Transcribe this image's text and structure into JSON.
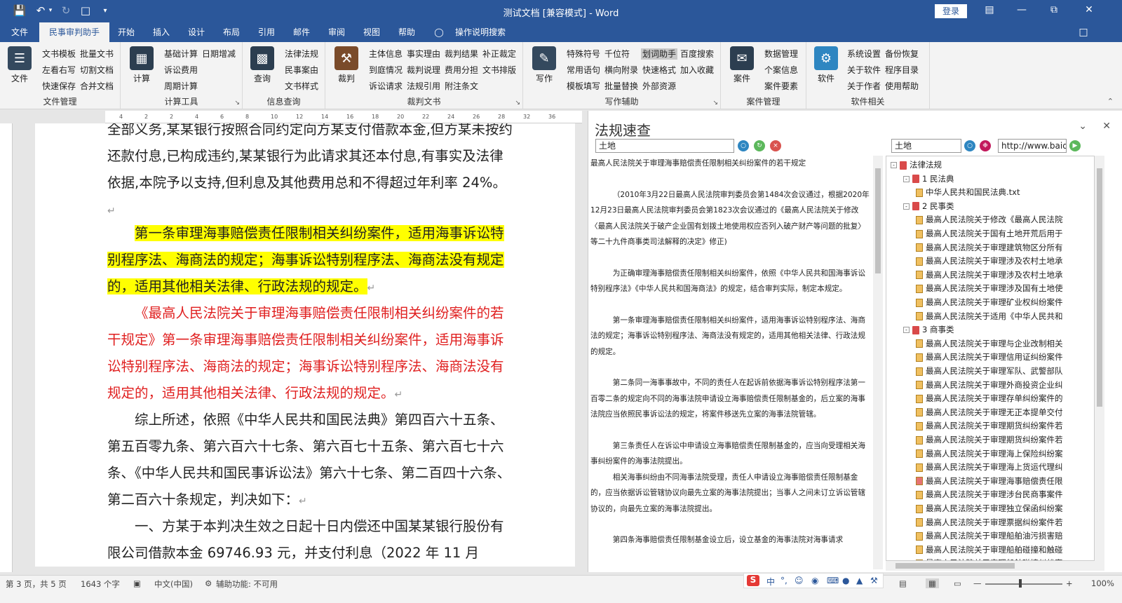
{
  "titlebar": {
    "title": "测试文档 [兼容模式] - Word",
    "login_label": "登录",
    "qa_icons": [
      "save-icon",
      "undo-icon",
      "redo-icon",
      "new-doc-icon",
      "customize-icon"
    ],
    "window_controls": [
      "ribbon-display-icon",
      "minimize-icon",
      "maximize-icon",
      "close-icon"
    ]
  },
  "tabs": [
    {
      "label": "文件"
    },
    {
      "label": "民事审判助手"
    },
    {
      "label": "开始"
    },
    {
      "label": "插入"
    },
    {
      "label": "设计"
    },
    {
      "label": "布局"
    },
    {
      "label": "引用"
    },
    {
      "label": "邮件"
    },
    {
      "label": "审阅"
    },
    {
      "label": "视图"
    },
    {
      "label": "帮助"
    },
    {
      "label": "操作说明搜索"
    }
  ],
  "ribbon": {
    "groups": [
      {
        "label": "文件管理",
        "big": "文件",
        "items": [
          "文书模板",
          "批量文书",
          "左看右写",
          "切割文档",
          "快速保存",
          "合并文档"
        ]
      },
      {
        "label": "计算工具",
        "big": "计算",
        "items": [
          "基础计算",
          "日期增减",
          "诉讼费用",
          "周期计算"
        ]
      },
      {
        "label": "信息查询",
        "big": "查询",
        "items": [
          "法律法规",
          "民事案由",
          "文书样式"
        ]
      },
      {
        "label": "裁判文书",
        "big": "裁判",
        "items": [
          "主体信息",
          "事实理由",
          "裁判结果",
          "补正裁定",
          "到庭情况",
          "裁判说理",
          "费用分担",
          "文书排版",
          "诉讼请求",
          "法规引用",
          "附注条文"
        ]
      },
      {
        "label": "写作辅助",
        "big": "写作",
        "items": [
          "特殊符号",
          "千位符",
          "划词助手",
          "百度搜索",
          "常用语句",
          "横向附录",
          "快速格式",
          "加入收藏",
          "模板填写",
          "批量替换",
          "外部资源"
        ]
      },
      {
        "label": "案件管理",
        "big": "案件",
        "items": [
          "数据管理",
          "个案信息",
          "案件要素"
        ]
      },
      {
        "label": "软件相关",
        "big": "软件",
        "items": [
          "系统设置",
          "备份恢复",
          "关于软件",
          "程序目录",
          "关于作者",
          "使用帮助"
        ]
      }
    ]
  },
  "ruler": {
    "numbers": [
      "4",
      "2",
      "2",
      "4",
      "6",
      "8",
      "10",
      "12",
      "14",
      "16",
      "18",
      "20",
      "22",
      "24",
      "26",
      "28",
      "32",
      "36"
    ]
  },
  "document": {
    "paragraphs": [
      {
        "text": "全部义务,某某银行按照合同约定向方某支付借款本金,但方某未按约还款付息,已构成违约,某某银行为此请求其还本付息,有事实及法律依据,本院予以支持,但利息及其他费用总和不得超过年利率 24%。",
        "style": "normal"
      },
      {
        "text": "第一条审理海事赔偿责任限制相关纠纷案件，适用海事诉讼特别程序法、海商法的规定；海事诉讼特别程序法、海商法没有规定的，适用其他相关法律、行政法规的规定。",
        "style": "highlight"
      },
      {
        "text": "《最高人民法院关于审理海事赔偿责任限制相关纠纷案件的若干规定》第一条审理海事赔偿责任限制相关纠纷案件，适用海事诉讼特别程序法、海商法的规定；海事诉讼特别程序法、海商法没有规定的，适用其他相关法律、行政法规的规定。",
        "style": "red"
      },
      {
        "text": "综上所述，依照《中华人民共和国民法典》第四百六十五条、第五百零九条、第六百六十七条、第六百七十五条、第六百七十六条、《中华人民共和国民事诉讼法》第六十七条、第二百四十六条、第二百六十条规定，判决如下：",
        "style": "normal"
      },
      {
        "text": "一、方某于本判决生效之日起十日内偿还中国某某银行股份有限公司借款本金 69746.93 元，并支付利息（2022 年 11 月",
        "style": "normal"
      }
    ]
  },
  "sidepanel": {
    "title": "法规速查",
    "search_left": "土地",
    "search_right": "土地",
    "url": "http://www.baidu",
    "law_text": [
      "最高人民法院关于审理海事赔偿责任限制相关纠纷案件的若干规定",
      "",
      "（2010年3月22日最高人民法院审判委员会第1484次会议通过，根据2020年12月23日最高人民法院审判委员会第1823次会议通过的《最高人民法院关于修改〈最高人民法院关于破产企业国有划拨土地使用权应否列入破产财产等问题的批复〉等二十九件商事类司法解释的决定》修正)",
      "",
      "为正确审理海事赔偿责任限制相关纠纷案件，依照《中华人民共和国海事诉讼特别程序法》《中华人民共和国海商法》的规定，结合审判实际，制定本规定。",
      "",
      "第一条审理海事赔偿责任限制相关纠纷案件，适用海事诉讼特别程序法、海商法的规定；海事诉讼特别程序法、海商法没有规定的，适用其他相关法律、行政法规的规定。",
      "",
      "第二条同一海事事故中，不同的责任人在起诉前依据海事诉讼特别程序法第一百零二条的规定向不同的海事法院申请设立海事赔偿责任限制基金的，后立案的海事法院应当依照民事诉讼法的规定，将案件移送先立案的海事法院管辖。",
      "",
      "第三条责任人在诉讼中申请设立海事赔偿责任限制基金的，应当向受理相关海事纠纷案件的海事法院提出。",
      "相关海事纠纷由不同海事法院受理，责任人申请设立海事赔偿责任限制基金的，应当依据诉讼管辖协议向最先立案的海事法院提出；当事人之间未订立诉讼管辖协议的，向最先立案的海事法院提出。",
      "",
      "第四条海事赔偿责任限制基金设立后，设立基金的海事法院对海事请求"
    ],
    "tree": [
      {
        "level": 0,
        "type": "book",
        "toggle": "-",
        "label": "法律法规"
      },
      {
        "level": 1,
        "type": "book",
        "toggle": "-",
        "label": "1 民法典"
      },
      {
        "level": 2,
        "type": "file",
        "label": "中华人民共和国民法典.txt"
      },
      {
        "level": 1,
        "type": "book",
        "toggle": "-",
        "label": "2 民事类"
      },
      {
        "level": 2,
        "type": "file",
        "label": "最高人民法院关于修改《最高人民法院"
      },
      {
        "level": 2,
        "type": "file",
        "label": "最高人民法院关于国有土地开荒后用于"
      },
      {
        "level": 2,
        "type": "file",
        "label": "最高人民法院关于审理建筑物区分所有"
      },
      {
        "level": 2,
        "type": "file",
        "label": "最高人民法院关于审理涉及农村土地承"
      },
      {
        "level": 2,
        "type": "file",
        "label": "最高人民法院关于审理涉及农村土地承"
      },
      {
        "level": 2,
        "type": "file",
        "label": "最高人民法院关于审理涉及国有土地使"
      },
      {
        "level": 2,
        "type": "file",
        "label": "最高人民法院关于审理矿业权纠纷案件"
      },
      {
        "level": 2,
        "type": "file",
        "label": "最高人民法院关于适用《中华人民共和"
      },
      {
        "level": 1,
        "type": "book",
        "toggle": "-",
        "label": "3 商事类"
      },
      {
        "level": 2,
        "type": "file",
        "label": "最高人民法院关于审理与企业改制相关"
      },
      {
        "level": 2,
        "type": "file",
        "label": "最高人民法院关于审理信用证纠纷案件"
      },
      {
        "level": 2,
        "type": "file",
        "label": "最高人民法院关于审理军队、武警部队"
      },
      {
        "level": 2,
        "type": "file",
        "label": "最高人民法院关于审理外商投资企业纠"
      },
      {
        "level": 2,
        "type": "file",
        "label": "最高人民法院关于审理存单纠纷案件的"
      },
      {
        "level": 2,
        "type": "file",
        "label": "最高人民法院关于审理无正本提单交付"
      },
      {
        "level": 2,
        "type": "file",
        "label": "最高人民法院关于审理期货纠纷案件若"
      },
      {
        "level": 2,
        "type": "file",
        "label": "最高人民法院关于审理期货纠纷案件若"
      },
      {
        "level": 2,
        "type": "file",
        "label": "最高人民法院关于审理海上保险纠纷案"
      },
      {
        "level": 2,
        "type": "file",
        "label": "最高人民法院关于审理海上货运代理纠"
      },
      {
        "level": 2,
        "type": "file-red",
        "label": "最高人民法院关于审理海事赔偿责任限"
      },
      {
        "level": 2,
        "type": "file",
        "label": "最高人民法院关于审理涉台民商事案件"
      },
      {
        "level": 2,
        "type": "file",
        "label": "最高人民法院关于审理独立保函纠纷案"
      },
      {
        "level": 2,
        "type": "file",
        "label": "最高人民法院关于审理票据纠纷案件若"
      },
      {
        "level": 2,
        "type": "file",
        "label": "最高人民法院关于审理船舶油污损害赔"
      },
      {
        "level": 2,
        "type": "file",
        "label": "最高人民法院关于审理船舶碰撞和触碰"
      },
      {
        "level": 2,
        "type": "file",
        "label": "最高人民法院关于审理船舶碰撞纠纷案"
      }
    ]
  },
  "statusbar": {
    "page": "第 3 页，共 5 页",
    "words": "1643 个字",
    "lang": "中文(中国)",
    "accessibility": "辅助功能: 不可用",
    "zoom": "100%",
    "ime_label": "中"
  },
  "colors": {
    "brand": "#2b579a",
    "highlight": "#ffff00",
    "red_text": "#e02020"
  }
}
